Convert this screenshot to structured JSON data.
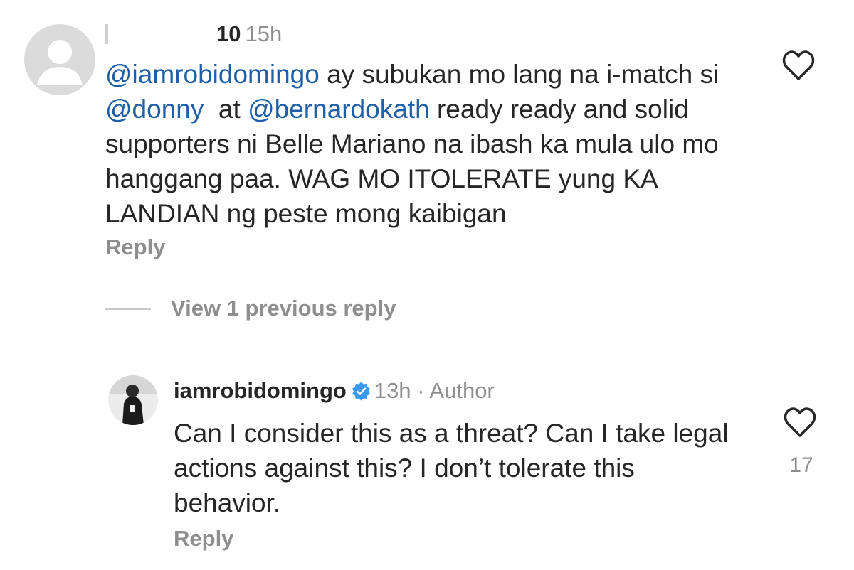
{
  "comment": {
    "like_count_prefix": "10",
    "time": "15h",
    "mention_1": "@iamrobidomingo",
    "text_1": " ay subukan mo lang na i-match si ",
    "mention_2": "@donny",
    "text_2": "  at ",
    "mention_3": "@bernardokath",
    "text_3": " ready ready and solid supporters ni Belle Mariano na ibash ka mula ulo mo hanggang paa. WAG MO ITOLERATE yung KA LANDIAN ng peste mong kaibigan",
    "reply_label": "Reply",
    "like_icon": "heart-outline-icon"
  },
  "thread": {
    "view_previous_label": "View 1 previous reply"
  },
  "reply": {
    "username": "iamrobidomingo",
    "time": "13h",
    "separator": "·",
    "author_label": "Author",
    "text": "Can I consider this as a threat? Can I take legal actions against this? I don’t tolerate this behavior.",
    "reply_label": "Reply",
    "like_count": "17",
    "like_icon": "heart-outline-icon"
  },
  "colors": {
    "mention": "#1f5fa8",
    "verified": "#3897f0",
    "muted": "#8e8e8e",
    "text": "#262626"
  }
}
